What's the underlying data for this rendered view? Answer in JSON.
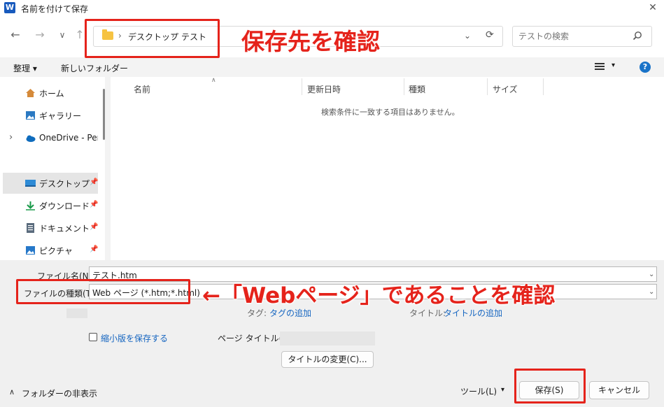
{
  "window": {
    "title": "名前を付けて保存",
    "app_icon": "W",
    "close": "✕"
  },
  "nav": {
    "back": "←",
    "forward": "→",
    "recent": "∨",
    "up": "↑",
    "breadcrumb": [
      "デスクトップ",
      "テスト"
    ],
    "separator": "›",
    "search_placeholder": "テストの検索"
  },
  "toolbar": {
    "organize": "整理 ▾",
    "new_folder": "新しいフォルダー",
    "view_chev": "▾",
    "help": "?"
  },
  "sidebar": {
    "items": [
      {
        "label": "ホーム",
        "icon": "home-icon"
      },
      {
        "label": "ギャラリー",
        "icon": "gallery-icon"
      },
      {
        "label": "OneDrive - Perso",
        "icon": "cloud-icon",
        "expander": "›"
      },
      {
        "label": "デスクトップ",
        "icon": "desktop-icon",
        "pinned": true,
        "selected": true
      },
      {
        "label": "ダウンロード",
        "icon": "download-icon",
        "pinned": true
      },
      {
        "label": "ドキュメント",
        "icon": "document-icon",
        "pinned": true
      },
      {
        "label": "ピクチャ",
        "icon": "picture-icon",
        "pinned": true
      }
    ],
    "pin": "📌"
  },
  "filelist": {
    "columns": [
      "名前",
      "更新日時",
      "種類",
      "サイズ"
    ],
    "empty_message": "検索条件に一致する項目はありません。"
  },
  "form": {
    "filename_label": "ファイル名(N):",
    "filename_value": "テスト.htm",
    "filetype_label": "ファイルの種類(T):",
    "filetype_value": "Web ページ (*.htm;*.html)",
    "tags_label": "タグ:",
    "tags_value": "タグの追加",
    "title_label": "タイトル:",
    "title_value": "タイトルの追加",
    "thumbnail_label": "縮小版を保存する",
    "page_title_label": "ページ タイトル(T):",
    "change_title_button": "タイトルの変更(C)..."
  },
  "footer": {
    "hide_folders": "フォルダーの非表示",
    "hide_chev": "∧",
    "tools": "ツール(L)",
    "tools_chev": "▾",
    "save": "保存(S)",
    "cancel": "キャンセル"
  },
  "annotations": {
    "save_location": "保存先を確認",
    "web_page": "←「Webページ」であることを確認"
  },
  "colors": {
    "annotation_red": "#e5231b",
    "accent_blue": "#1a73c8",
    "link_blue": "#1565c0"
  }
}
